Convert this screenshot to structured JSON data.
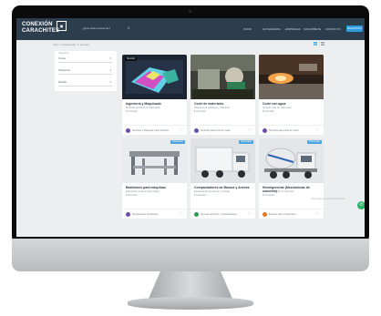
{
  "header": {
    "logo_line1": "CONEXIÓN",
    "logo_line2": "CARACHITES",
    "logo_box": "▣",
    "search_placeholder": "¿Qué estás buscando?",
    "nav": [
      "INICIO",
      "CATEGORÍAS",
      "EMPRESAS",
      "SUSCRÍBETE",
      "CONTACTO"
    ],
    "register_label": "REGISTRO"
  },
  "breadcrumb": "Inicio / Clasificados  ✕  Limpiar",
  "filters": [
    {
      "label": "Categoría",
      "value": "Todos"
    },
    {
      "label": "",
      "value": "Ubicación"
    },
    {
      "label": "",
      "value": "Estado"
    }
  ],
  "cards": [
    {
      "title": "Ingeniería y Maquinado",
      "subtitle": "Servicios de diseño de fabricación",
      "price": "$ Consultar",
      "seller": "Servicios y Maquinas para Industria",
      "badge": "Servicio",
      "badge_right": ""
    },
    {
      "title": "Corte de materiales",
      "subtitle": "Máquinas de cortadora y máquinas",
      "price": "$ Consultar",
      "seller": "Servicios para corte de metal",
      "badge": "",
      "badge_right": ""
    },
    {
      "title": "Corte con agua",
      "subtitle": "Servicio corte de maquinaria",
      "price": "$ Consultar",
      "seller": "Servicios para corte de metal",
      "badge": "",
      "badge_right": ""
    },
    {
      "title": "Bastidores para máquinas",
      "subtitle": "Estructuras de acero para equipo",
      "price": "$ Consultar",
      "seller": "Herramientas industriales",
      "badge": "",
      "badge_right": "Destacado"
    },
    {
      "title": "Compactadores de Basura y Anexos",
      "subtitle": "Equipamiento de basura y reciclaje",
      "price": "$ Consultar",
      "seller": "Servicio vehículos y compactadores",
      "badge": "",
      "badge_right": "Destacado"
    },
    {
      "title": "Hormigoneras (Mezcladoras de concreto)",
      "subtitle": "Para construcción de obra civil",
      "price": "$ Consultar",
      "seller": "Equipos para construcción",
      "badge": "",
      "badge_right": "Destacado"
    }
  ],
  "chat": {
    "tip": "¿Tienes alguna duda? Escríbenos",
    "icon": "whatsapp-icon"
  },
  "colors": {
    "topbar": "#2c3e4e",
    "accent": "#2f9be0",
    "whatsapp": "#29b36a"
  }
}
